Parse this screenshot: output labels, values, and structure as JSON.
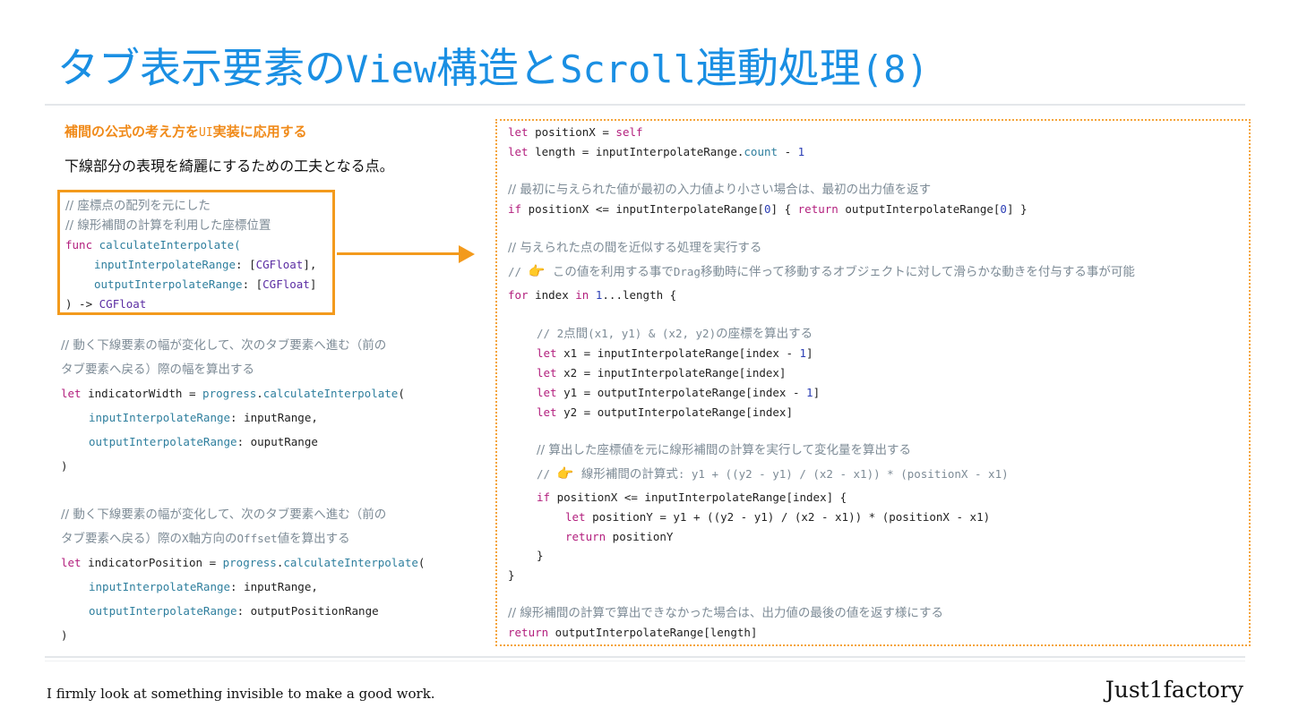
{
  "slide": {
    "title_prefix": "タブ表示要素の",
    "title_view": "View",
    "title_mid": "構造と",
    "title_scroll": "Scroll",
    "title_suffix": "連動処理",
    "title_number": "(8)",
    "subtitle_a": "補間の公式の考え方を",
    "subtitle_ui": "UI",
    "subtitle_b": "実装に応用する",
    "lead": "下線部分の表現を綺麗にするための工夫となる点。"
  },
  "func_box": {
    "comment1": "// 座標点の配列を元にした",
    "comment2": "// 線形補間の計算を利用した座標位置",
    "func_kw": "func",
    "func_name": "calculateInterpolate(",
    "param1_name": "inputInterpolateRange",
    "param1_sep": ": [",
    "param1_type": "CGFloat",
    "param1_end": "],",
    "param2_name": "outputInterpolateRange",
    "param2_sep": ": [",
    "param2_type": "CGFloat",
    "param2_end": "]",
    "ret_open": ") -> ",
    "ret_type": "CGFloat"
  },
  "left_code": {
    "width_comment1": "// 動く下線要素の幅が変化して、次のタブ要素へ進む（前の",
    "width_comment2": "タブ要素へ戻る）際の幅を算出する",
    "let": "let",
    "width_var": " indicatorWidth = ",
    "progress": "progress",
    "dot": ".",
    "calc": "calculateInterpolate",
    "paren": "(",
    "in_param": "inputInterpolateRange",
    "in_val": ": inputRange,",
    "out_param": "outputInterpolateRange",
    "out_val_width": ": ouputRange",
    "close": ")",
    "pos_comment1": "// 動く下線要素の幅が変化して、次のタブ要素へ進む（前の",
    "pos_comment2a": "タブ要素へ戻る）際の",
    "pos_comment2b": "X",
    "pos_comment2c": "軸方向の",
    "pos_comment2d": "Offset",
    "pos_comment2e": "値を算出する",
    "pos_var": " indicatorPosition = ",
    "out_val_pos": ": outputPositionRange"
  },
  "right_code": {
    "l1_kw": "let",
    "l1_a": " positionX = ",
    "l1_self": "self",
    "l2_kw": "let",
    "l2_a": " length = inputInterpolateRange.",
    "l2_count": "count",
    "l2_b": " - ",
    "l2_num": "1",
    "c1": "// 最初に与えられた値が最初の入力値より小さい場合は、最初の出力値を返す",
    "l3_if": "if",
    "l3_a": " positionX <= inputInterpolateRange[",
    "l3_n1": "0",
    "l3_b": "] { ",
    "l3_ret": "return",
    "l3_c": " outputInterpolateRange[",
    "l3_n2": "0",
    "l3_d": "] }",
    "c2": "// 与えられた点の間を近似する処理を実行する",
    "c3_a": "// ",
    "c3_emoji": "👉",
    "c3_b": "  この値を利用する事で",
    "c3_drag": "Drag",
    "c3_c": "移動時に伴って移動するオブジェクトに対して滑らかな動きを付与する事が可能",
    "for_kw": "for",
    "for_a": " index ",
    "for_in": "in",
    "for_b": " ",
    "for_num": "1",
    "for_c": "...length {",
    "c4_a": "// ",
    "c4_b": "2",
    "c4_c": "点間",
    "c4_d": "(x1, y1) & (x2, y2)",
    "c4_e": "の座標を算出する",
    "x1_kw": "let",
    "x1_a": " x1 = inputInterpolateRange[index - ",
    "x1_n": "1",
    "x1_b": "]",
    "x2_kw": "let",
    "x2_a": " x2 = inputInterpolateRange[index]",
    "y1_kw": "let",
    "y1_a": " y1 = outputInterpolateRange[index - ",
    "y1_n": "1",
    "y1_b": "]",
    "y2_kw": "let",
    "y2_a": " y2 = outputInterpolateRange[index]",
    "c5": "// 算出した座標値を元に線形補間の計算を実行して変化量を算出する",
    "c6_a": "// ",
    "c6_emoji": "👉",
    "c6_b": "  線形補間の計算式",
    "c6_c": ": y1 + ((y2 - y1) / (x2 - x1)) * (positionX - x1)",
    "if2_kw": "if",
    "if2_a": " positionX <= inputInterpolateRange[index] {",
    "py_kw": "let",
    "py_a": " positionY = y1 + ((y2 - y1) / (x2 - x1)) * (positionX - x1)",
    "ret2_kw": "return",
    "ret2_a": " positionY",
    "brace_inner": "}",
    "brace_outer": "}",
    "c7": "// 線形補間の計算で算出できなかった場合は、出力値の最後の値を返す様にする",
    "ret3_kw": "return",
    "ret3_a": " outputInterpolateRange[length]"
  },
  "footer": {
    "tagline": "I firmly look at something invisible to make a good work.",
    "brand": "Just1factory"
  }
}
